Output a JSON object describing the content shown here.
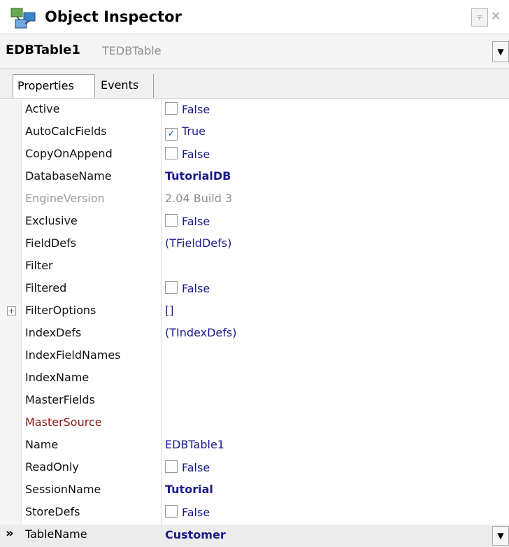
{
  "window": {
    "title": "Object Inspector",
    "pin_glyph": "⫧",
    "close_glyph": "✕"
  },
  "selector": {
    "component_name": "EDBTable1",
    "component_type": "TEDBTable",
    "dropdown_glyph": "▼"
  },
  "tabs": [
    {
      "label": "Properties",
      "active": true
    },
    {
      "label": "Events",
      "active": false
    }
  ],
  "properties": [
    {
      "name": "Active",
      "value": "False",
      "checkbox": true,
      "checked": false
    },
    {
      "name": "AutoCalcFields",
      "value": "True",
      "checkbox": true,
      "checked": true
    },
    {
      "name": "CopyOnAppend",
      "value": "False",
      "checkbox": true,
      "checked": false
    },
    {
      "name": "DatabaseName",
      "value": "TutorialDB",
      "bold": true
    },
    {
      "name": "EngineVersion",
      "value": "2.04 Build 3",
      "readonly": true
    },
    {
      "name": "Exclusive",
      "value": "False",
      "checkbox": true,
      "checked": false
    },
    {
      "name": "FieldDefs",
      "value": "(TFieldDefs)"
    },
    {
      "name": "Filter",
      "value": ""
    },
    {
      "name": "Filtered",
      "value": "False",
      "checkbox": true,
      "checked": false
    },
    {
      "name": "FilterOptions",
      "value": "[]",
      "expandable": true
    },
    {
      "name": "IndexDefs",
      "value": "(TIndexDefs)"
    },
    {
      "name": "IndexFieldNames",
      "value": ""
    },
    {
      "name": "IndexName",
      "value": ""
    },
    {
      "name": "MasterFields",
      "value": ""
    },
    {
      "name": "MasterSource",
      "value": "",
      "reference": true
    },
    {
      "name": "Name",
      "value": "EDBTable1"
    },
    {
      "name": "ReadOnly",
      "value": "False",
      "checkbox": true,
      "checked": false
    },
    {
      "name": "SessionName",
      "value": "Tutorial",
      "bold": true
    },
    {
      "name": "StoreDefs",
      "value": "False",
      "checkbox": true,
      "checked": false
    },
    {
      "name": "TableName",
      "value": "Customer",
      "bold": true,
      "selected": true
    }
  ],
  "indicators": {
    "expand_glyph": "+",
    "current_row_glyph": "»",
    "check_glyph": "✓",
    "dropdown_glyph": "▼"
  },
  "colors": {
    "value_text": "#1a1a8c",
    "readonly_text": "#8e8e8e",
    "reference_text": "#8b1414"
  }
}
